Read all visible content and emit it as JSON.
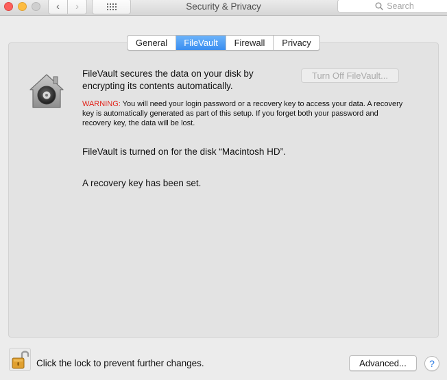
{
  "window": {
    "title": "Security & Privacy",
    "nav_back": "‹",
    "nav_forward": "›",
    "search_placeholder": "Search"
  },
  "tabs": [
    {
      "label": "General",
      "active": false
    },
    {
      "label": "FileVault",
      "active": true
    },
    {
      "label": "Firewall",
      "active": false
    },
    {
      "label": "Privacy",
      "active": false
    }
  ],
  "filevault": {
    "description": "FileVault secures the data on your disk by encrypting its contents automatically.",
    "turn_off_button": "Turn Off FileVault...",
    "warning_label": "WARNING:",
    "warning_text": " You will need your login password or a recovery key to access your data. A recovery key is automatically generated as part of this setup. If you forget both your password and recovery key, the data will be lost.",
    "status_disk": "FileVault is turned on for the disk “Macintosh HD”.",
    "status_recovery": "A recovery key has been set."
  },
  "footer": {
    "lock_text": "Click the lock to prevent further changes.",
    "advanced_button": "Advanced...",
    "help_label": "?"
  },
  "icons": {
    "filevault": "filevault-house-icon",
    "lock": "open-lock-icon",
    "search": "search-icon",
    "grid": "grid-icon"
  },
  "colors": {
    "accent": "#3a8ef0",
    "warning": "#e2231a"
  }
}
